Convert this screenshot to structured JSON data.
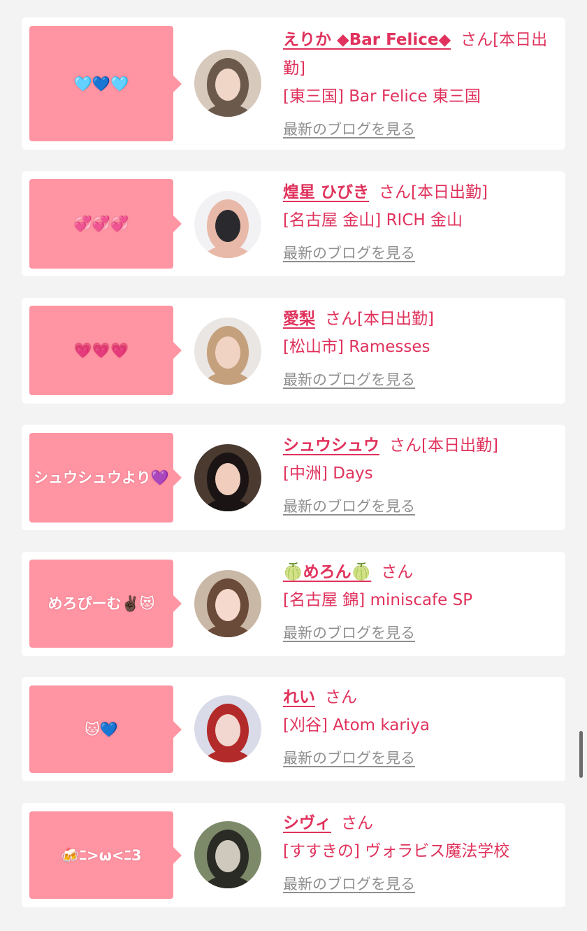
{
  "cards": [
    {
      "message": "🩵💙🩵",
      "name": "えりか ◆Bar Felice◆",
      "suffix": "さん[本日出勤]",
      "shop": "[東三国] Bar Felice 東三国",
      "blog_link": "最新のブログを見る",
      "avatar_colors": [
        "#d8c9bd",
        "#6b5a4c",
        "#f0d6c7"
      ]
    },
    {
      "message": "💞💞💞",
      "name": "煌星 ひびき",
      "suffix": "さん[本日出勤]",
      "shop": "[名古屋 金山] RICH 金山",
      "blog_link": "最新のブログを見る",
      "avatar_colors": [
        "#f2f2f4",
        "#e8b9a8",
        "#2a2a2e"
      ]
    },
    {
      "message": "💗💗💗",
      "name": "愛梨",
      "suffix": "さん[本日出勤]",
      "shop": "[松山市] Ramesses",
      "blog_link": "最新のブログを見る",
      "avatar_colors": [
        "#e9e6e3",
        "#c5a07d",
        "#f1d3c3"
      ]
    },
    {
      "message": "シュウシュウより💜",
      "name": "シュウシュウ",
      "suffix": "さん[本日出勤]",
      "shop": "[中洲] Days",
      "blog_link": "最新のブログを見る",
      "avatar_colors": [
        "#4a3a30",
        "#1a1414",
        "#f0cdbd"
      ]
    },
    {
      "message": "めろぴーむ✌🏿😻",
      "name": "🍈めろん🍈",
      "suffix": "さん",
      "shop": "[名古屋 錦] miniscafe SP",
      "blog_link": "最新のブログを見る",
      "avatar_colors": [
        "#c9b8a6",
        "#6a4a38",
        "#f4d9cc"
      ]
    },
    {
      "message": "🐱💙",
      "name": "れい",
      "suffix": "さん",
      "shop": "[刈谷] Atom kariya",
      "blog_link": "最新のブログを見る",
      "avatar_colors": [
        "#d9dbe8",
        "#b32a2a",
        "#f1d7cf"
      ]
    },
    {
      "message": "🍻ﾆ>ω<ﾆ3",
      "name": "シヴィ",
      "suffix": "さん",
      "shop": "[すすきの] ヴォラビス魔法学校",
      "blog_link": "最新のブログを見る",
      "avatar_colors": [
        "#7d8a6a",
        "#2b2b26",
        "#cfc9bd"
      ]
    }
  ],
  "colors": {
    "accent": "#e0325c",
    "bubble": "#ff95a3",
    "link": "#8f8f8f",
    "background": "#f3f3f3"
  }
}
